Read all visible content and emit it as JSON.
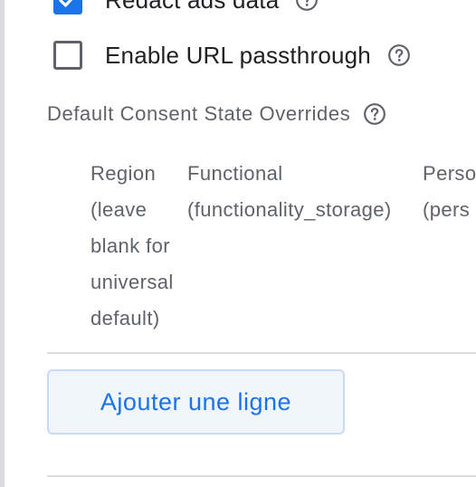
{
  "redact_ads": {
    "label": "Redact ads data",
    "checked": true
  },
  "url_passthrough": {
    "label": "Enable URL passthrough",
    "checked": false
  },
  "consent_overrides": {
    "section_label": "Default Consent State Overrides",
    "columns": [
      {
        "header": "Region\n(leave\nblank for\nuniversal\ndefault)"
      },
      {
        "header": "Functional\n(functionality_storage)"
      },
      {
        "header": "Perso\n(pers"
      }
    ],
    "add_row_label": "Ajouter une ligne"
  },
  "colors": {
    "accent": "#1a73e8",
    "button_bg": "#f1f6fd",
    "secondary_text": "#5f6368",
    "divider": "#dadce0"
  },
  "icons": {
    "checkmark": "check-icon",
    "help": "help-circle-icon"
  }
}
